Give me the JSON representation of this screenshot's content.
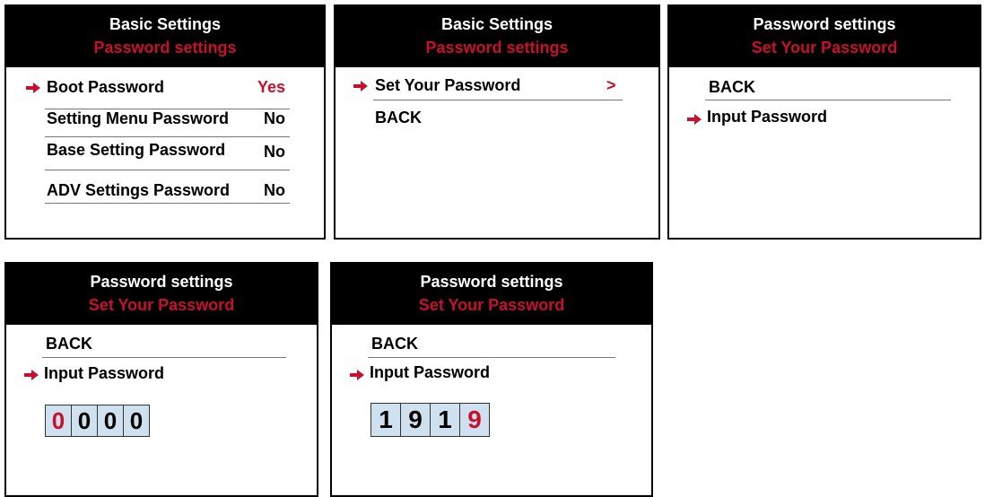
{
  "colors": {
    "accent": "#c8102e",
    "header_bg": "#000000",
    "digit_bg": "#cfe0ef"
  },
  "panel1": {
    "title": "Basic Settings",
    "subtitle": "Password settings",
    "items": [
      {
        "label": "Boot Password",
        "value": "Yes"
      },
      {
        "label": "Setting Menu Password",
        "value": "No"
      },
      {
        "label": "Base Setting Password",
        "value": "No"
      },
      {
        "label": "ADV Settings Password",
        "value": "No"
      }
    ]
  },
  "panel2": {
    "title": "Basic Settings",
    "subtitle": "Password settings",
    "item1": "Set Your Password",
    "item1_indicator": ">",
    "back": "BACK"
  },
  "panel3": {
    "title": "Password settings",
    "subtitle": "Set Your Password",
    "back": "BACK",
    "input_label": "Input Password"
  },
  "panel4": {
    "title": "Password settings",
    "subtitle": "Set Your Password",
    "back": "BACK",
    "input_label": "Input Password",
    "digits": [
      "0",
      "0",
      "0",
      "0"
    ]
  },
  "panel5": {
    "title": "Password settings",
    "subtitle": "Set Your Password",
    "back": "BACK",
    "input_label": "Input Password",
    "digits": [
      "1",
      "9",
      "1",
      "9"
    ]
  },
  "icons": {
    "selection": "right-arrow-icon"
  }
}
